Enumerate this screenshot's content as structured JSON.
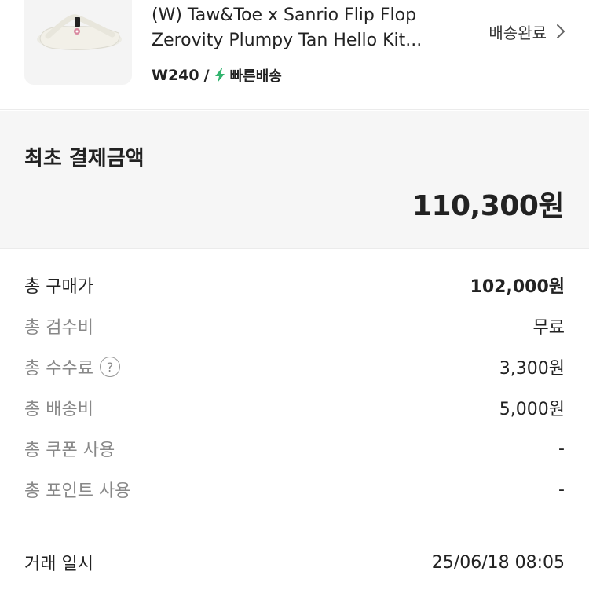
{
  "product": {
    "title": "(W) Taw&Toe x Sanrio Flip Flop Zerovity Plumpy Tan Hello Kit...",
    "size": "W240",
    "slash": "/",
    "fast_delivery": "빠른배송",
    "status": "배송완료",
    "accent_color": "#31b46e"
  },
  "payment": {
    "total_label": "최초 결제금액",
    "total_value": "110,300원"
  },
  "breakdown": [
    {
      "label": "총 구매가",
      "value": "102,000원"
    },
    {
      "label": "총 검수비",
      "value": "무료"
    },
    {
      "label": "총 수수료",
      "value": "3,300원",
      "help_icon": "?"
    },
    {
      "label": "총 배송비",
      "value": "5,000원"
    },
    {
      "label": "총 쿠폰 사용",
      "value": "-"
    },
    {
      "label": "총 포인트 사용",
      "value": "-"
    }
  ],
  "trade": {
    "label": "거래 일시",
    "value": "25/06/18 08:05"
  }
}
